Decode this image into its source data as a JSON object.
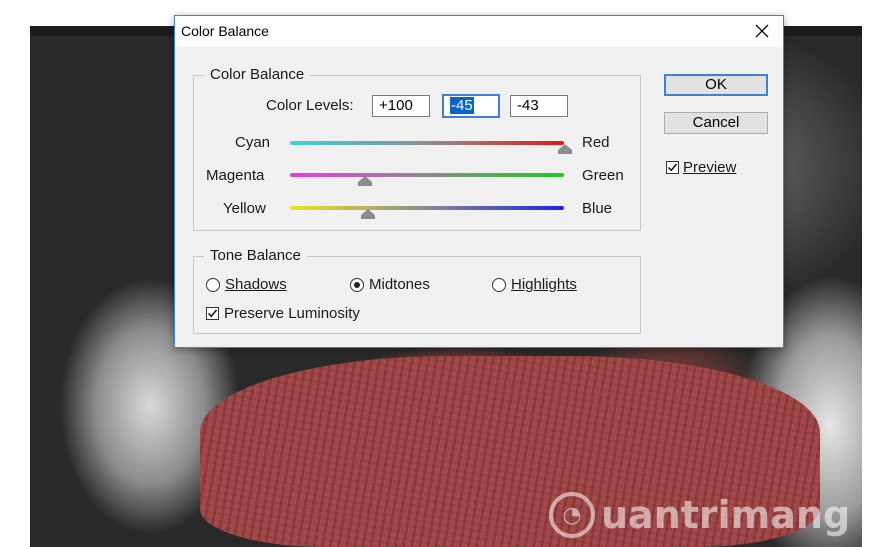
{
  "dialog": {
    "title": "Color Balance",
    "color_balance": {
      "group_label": "Color Balance",
      "color_levels_label": "Color Levels:",
      "levels": [
        "+100",
        "-45",
        "-43"
      ],
      "sliders": [
        {
          "left": "Cyan",
          "right": "Red",
          "value": 100
        },
        {
          "left": "Magenta",
          "right": "Green",
          "value": -45
        },
        {
          "left": "Yellow",
          "right": "Blue",
          "value": -43
        }
      ]
    },
    "tone_balance": {
      "group_label": "Tone Balance",
      "options": [
        "Shadows",
        "Midtones",
        "Highlights"
      ],
      "selected": "Midtones",
      "preserve_luminosity_label": "Preserve Luminosity",
      "preserve_luminosity_checked": true
    },
    "buttons": {
      "ok": "OK",
      "cancel": "Cancel"
    },
    "preview": {
      "label": "Preview",
      "checked": true
    }
  },
  "watermark": "uantrimang",
  "colors": {
    "accent": "#3b82d6",
    "scarf": "#a04242"
  }
}
